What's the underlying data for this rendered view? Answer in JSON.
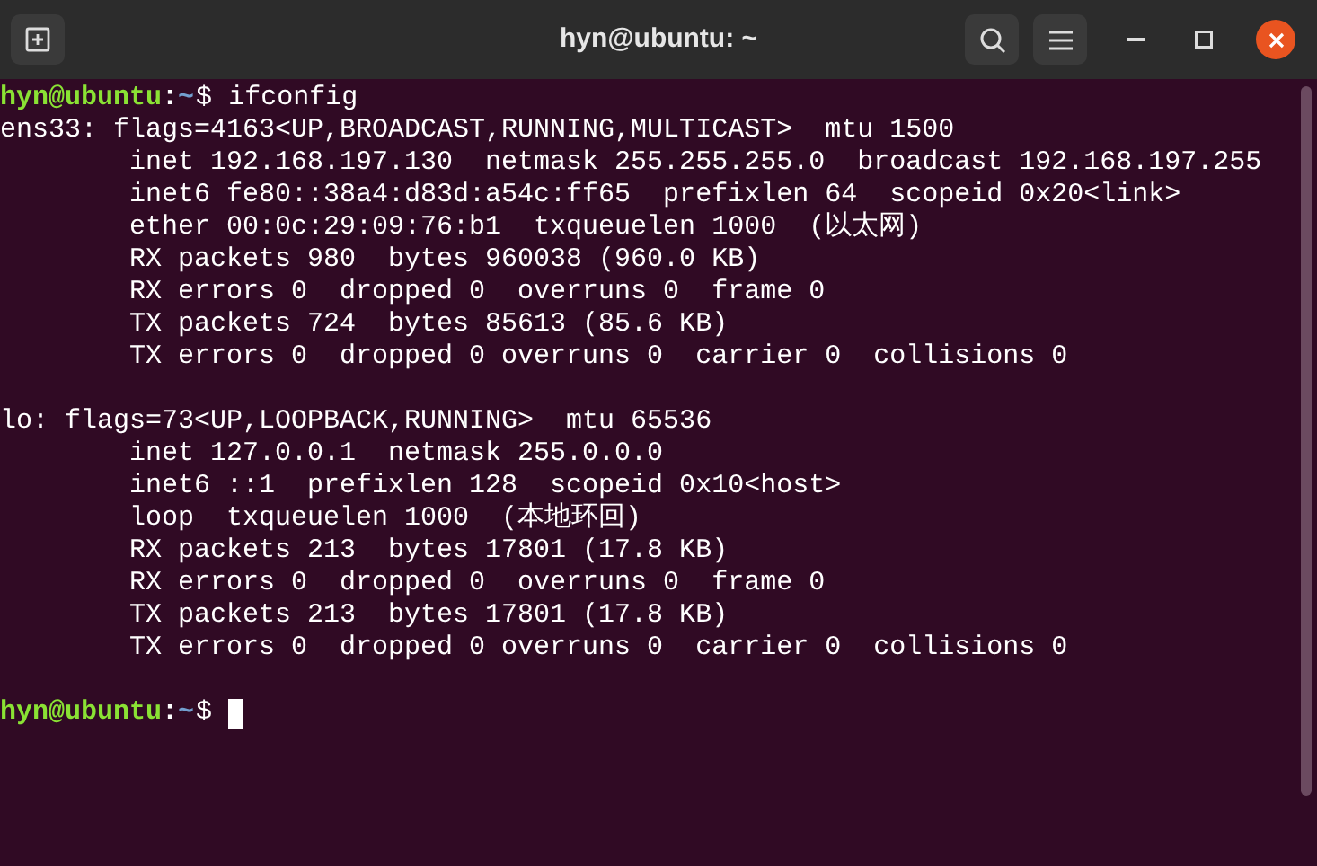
{
  "window": {
    "title": "hyn@ubuntu: ~"
  },
  "terminal": {
    "lines": [
      {
        "kind": "prompt",
        "user_host": "hyn@ubuntu",
        "separator": ":",
        "path": "~",
        "symbol": "$",
        "command": "ifconfig",
        "cursor": false
      },
      {
        "kind": "output",
        "text": "ens33: flags=4163<UP,BROADCAST,RUNNING,MULTICAST>  mtu 1500"
      },
      {
        "kind": "output",
        "text": "        inet 192.168.197.130  netmask 255.255.255.0  broadcast 192.168.197.255"
      },
      {
        "kind": "output",
        "text": "        inet6 fe80::38a4:d83d:a54c:ff65  prefixlen 64  scopeid 0x20<link>"
      },
      {
        "kind": "output",
        "text": "        ether 00:0c:29:09:76:b1  txqueuelen 1000  (以太网)"
      },
      {
        "kind": "output",
        "text": "        RX packets 980  bytes 960038 (960.0 KB)"
      },
      {
        "kind": "output",
        "text": "        RX errors 0  dropped 0  overruns 0  frame 0"
      },
      {
        "kind": "output",
        "text": "        TX packets 724  bytes 85613 (85.6 KB)"
      },
      {
        "kind": "output",
        "text": "        TX errors 0  dropped 0 overruns 0  carrier 0  collisions 0"
      },
      {
        "kind": "blank"
      },
      {
        "kind": "output",
        "text": "lo: flags=73<UP,LOOPBACK,RUNNING>  mtu 65536"
      },
      {
        "kind": "output",
        "text": "        inet 127.0.0.1  netmask 255.0.0.0"
      },
      {
        "kind": "output",
        "text": "        inet6 ::1  prefixlen 128  scopeid 0x10<host>"
      },
      {
        "kind": "output",
        "text": "        loop  txqueuelen 1000  (本地环回)"
      },
      {
        "kind": "output",
        "text": "        RX packets 213  bytes 17801 (17.8 KB)"
      },
      {
        "kind": "output",
        "text": "        RX errors 0  dropped 0  overruns 0  frame 0"
      },
      {
        "kind": "output",
        "text": "        TX packets 213  bytes 17801 (17.8 KB)"
      },
      {
        "kind": "output",
        "text": "        TX errors 0  dropped 0 overruns 0  carrier 0  collisions 0"
      },
      {
        "kind": "blank"
      },
      {
        "kind": "prompt",
        "user_host": "hyn@ubuntu",
        "separator": ":",
        "path": "~",
        "symbol": "$",
        "cursor": true
      }
    ]
  }
}
